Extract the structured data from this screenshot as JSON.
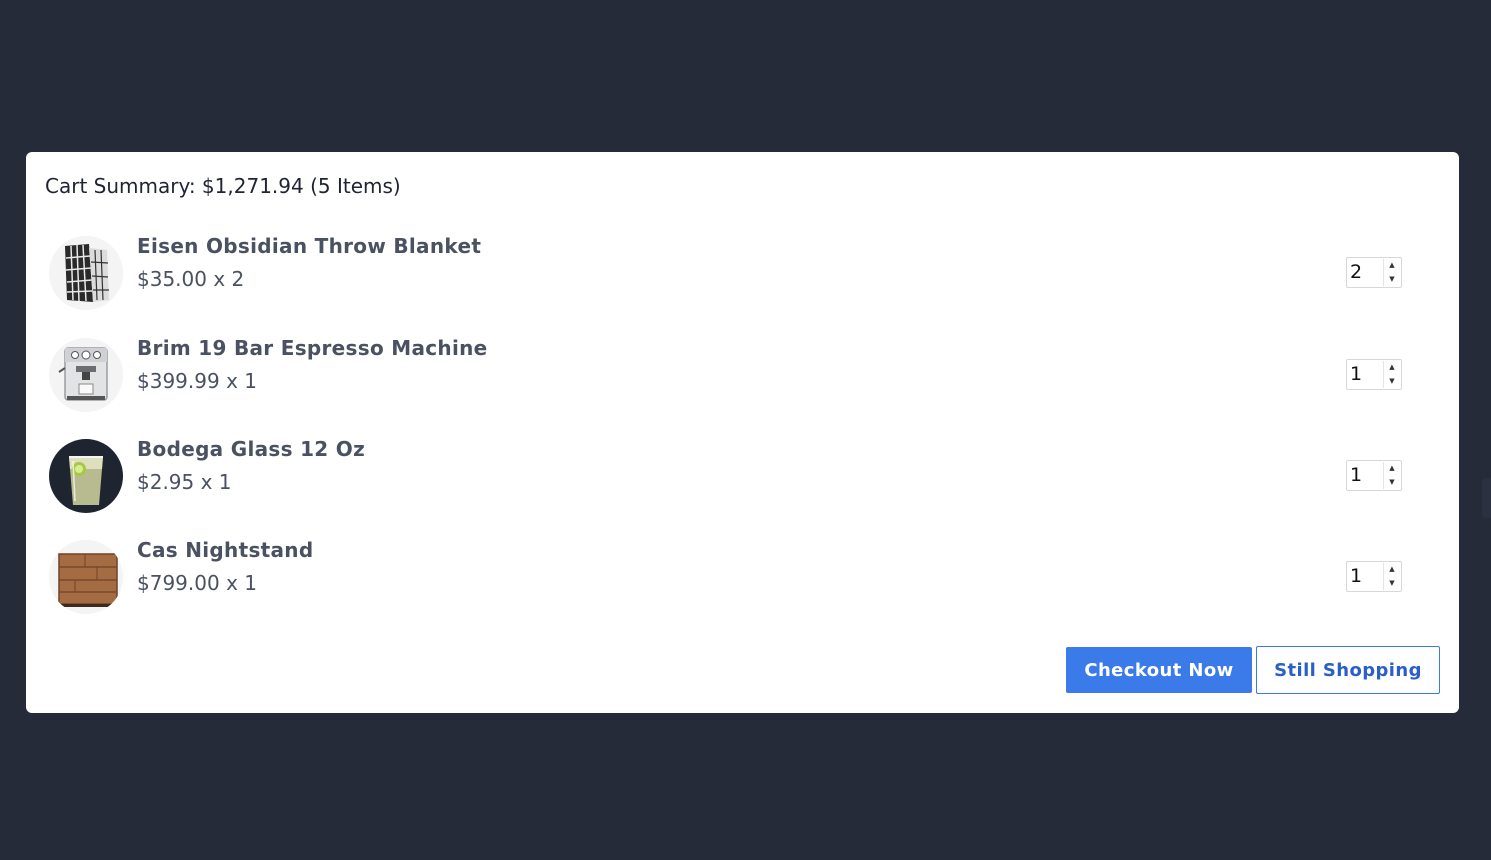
{
  "cart": {
    "summary": "Cart Summary: $1,271.94 (5 Items)",
    "items": [
      {
        "name": "Eisen Obsidian Throw Blanket",
        "price": "$35.00 x 2",
        "quantity": "2",
        "image_icon": "throw-blanket-thumbnail"
      },
      {
        "name": "Brim 19 Bar Espresso Machine",
        "price": "$399.99 x 1",
        "quantity": "1",
        "image_icon": "espresso-machine-thumbnail"
      },
      {
        "name": "Bodega Glass 12 Oz",
        "price": "$2.95 x 1",
        "quantity": "1",
        "image_icon": "glass-thumbnail"
      },
      {
        "name": "Cas Nightstand",
        "price": "$799.00 x 1",
        "quantity": "1",
        "image_icon": "nightstand-thumbnail"
      }
    ],
    "actions": {
      "checkout_label": "Checkout Now",
      "still_shopping_label": "Still Shopping"
    }
  },
  "colors": {
    "backdrop": "#252b39",
    "primary": "#3b7be9",
    "text": "#4a5160"
  }
}
